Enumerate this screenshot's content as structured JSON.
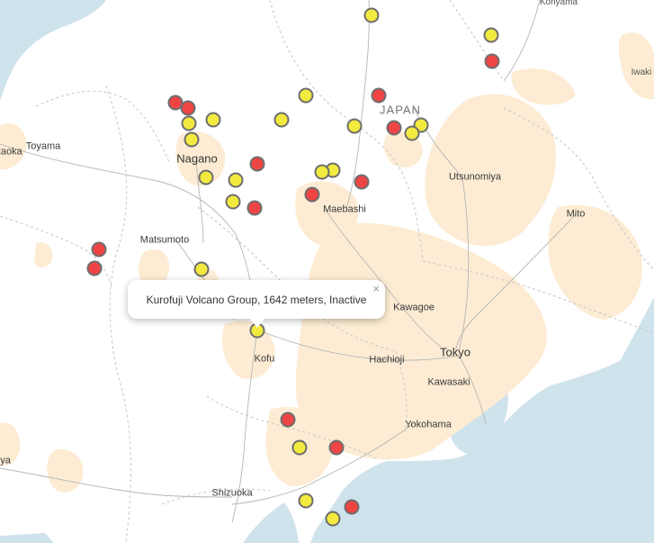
{
  "map": {
    "country_label": "JAPAN",
    "colors": {
      "water": "#cfe3ec",
      "land": "#ffffff",
      "urban": "#fdecd3",
      "active_volcano": "#ef4444",
      "inactive_volcano": "#f3ea3f",
      "marker_border": "#6e6e6e"
    },
    "cities": {
      "koriyama": "Koriyama",
      "iwaki": "Iwaki",
      "toyama": "Toyama",
      "kaoka": "kaoka",
      "nagano": "Nagano",
      "utsunomiya": "Utsunomiya",
      "maebashi": "Maebashi",
      "mito": "Mito",
      "matsumoto": "Matsumoto",
      "kawagoe": "Kawagoe",
      "kofu": "Kofu",
      "hachioji": "Hachioji",
      "tokyo": "Tokyo",
      "kawasaki": "Kawasaki",
      "yokohama": "Yokohama",
      "ya": "ya",
      "shizuoka": "Shizuoka"
    },
    "popup": {
      "text": "Kurofuji Volcano Group, 1642 meters, Inactive",
      "close": "×"
    }
  }
}
